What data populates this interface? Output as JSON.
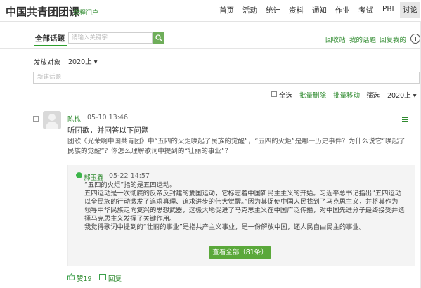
{
  "header": {
    "brand": "中国共青团团课",
    "brand_sub": "课程门户",
    "nav": [
      "首页",
      "活动",
      "统计",
      "资料",
      "通知",
      "作业",
      "考试",
      "PBL",
      "讨论"
    ]
  },
  "topics": {
    "tab_all": "全部话题",
    "search_placeholder": "请输入关键字",
    "links": [
      "回收站",
      "我的话题",
      "回复我的"
    ]
  },
  "audience": {
    "label": "发放对象",
    "selected": "2020上",
    "new_topic_placeholder": "新建话题"
  },
  "toolbar": {
    "select_all": "全选",
    "batch_delete": "批量删除",
    "batch_move": "批量移动",
    "filter_label": "筛选",
    "filter_value": "2020上"
  },
  "post": {
    "author": "陈栋",
    "time": "05-10 13:46",
    "title": "听团歌，并回答以下问题",
    "body": "团歌《光荣啊中国共青团》中“五四的火炬唤起了民族的觉醒”，“五四的火炬”是哪一历史事件？为什么说它“唤起了民族的觉醒”？你怎么理解歌词中提到的“壮丽的事业”？",
    "reply": {
      "author": "郝玉鑫",
      "time": "05-22 14:57",
      "lines": [
        "“五四的火炬”指的是五四运动。",
        "五四运动是一次彻底的反帝反封建的爱国运动，它标志着中国新民主主义的开始。习近平总书记指出“五四运动",
        "以全民族的行动激发了追求真理、追求进步的伟大觉醒。”因为其促使中国人民找到了马克思主义，并将其作为",
        "领导中华民族走向复兴的思想武器，这极大地促进了马克思主义在中国广泛传播，对中国先进分子最终接受并选",
        "择马克思主义发挥了关键作用。",
        "我觉得歌词中提到的“壮丽的事业”是指共产主义事业，是一份解放中国，还人民自由民主的事业。"
      ]
    },
    "view_all": "查看全部（81条）",
    "likes": "赞19",
    "reply_label": "回复"
  },
  "colors": {
    "accent": "#2e8a2e",
    "button": "#5aa83a"
  }
}
